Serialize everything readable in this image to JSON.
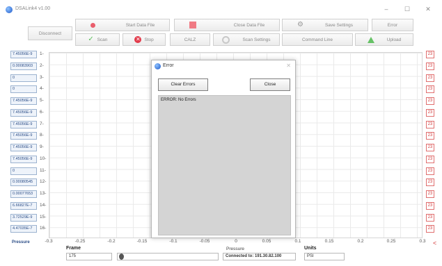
{
  "window": {
    "title": "DSALink4 v1.00",
    "minimize": "–",
    "maximize": "☐",
    "close": "✕"
  },
  "toolbar": {
    "disconnect": "Disconnect",
    "start_data_file": "Start Data File",
    "close_data_file": "Close Data File",
    "save_settings": "Save Settings",
    "error": "Error",
    "scan": "Scan",
    "stop": "Stop",
    "calz": "CALZ",
    "scan_settings": "Scan Settings",
    "command_line": "Command Line",
    "upload": "Upload"
  },
  "channels": [
    {
      "num": "1-",
      "value": "7.45056E-9",
      "right": "23"
    },
    {
      "num": "2-",
      "value": "0.00083903",
      "right": "23"
    },
    {
      "num": "3-",
      "value": "0",
      "right": "23"
    },
    {
      "num": "4-",
      "value": "0",
      "right": "23"
    },
    {
      "num": "5-",
      "value": "7.45056E-9",
      "right": "23"
    },
    {
      "num": "6-",
      "value": "7.45056E-9",
      "right": "23"
    },
    {
      "num": "7-",
      "value": "7.45056E-9",
      "right": "23"
    },
    {
      "num": "8-",
      "value": "7.45056E-9",
      "right": "23"
    },
    {
      "num": "9-",
      "value": "7.45056E-9",
      "right": "23"
    },
    {
      "num": "10-",
      "value": "7.45056E-9",
      "right": "23"
    },
    {
      "num": "11-",
      "value": "0",
      "right": "23"
    },
    {
      "num": "12-",
      "value": "0.00080545",
      "right": "23"
    },
    {
      "num": "13-",
      "value": "0.00077653",
      "right": "23"
    },
    {
      "num": "14-",
      "value": "6.66827E-7",
      "right": "23"
    },
    {
      "num": "15-",
      "value": "3.72529E-9",
      "right": "23"
    },
    {
      "num": "16-",
      "value": "4.47035E-7",
      "right": "23"
    }
  ],
  "plot": {
    "x_ticks": [
      "-0.3",
      "-0.25",
      "-0.2",
      "-0.15",
      "-0.1",
      "-0.05",
      "0",
      "0.05",
      "0.1",
      "0.15",
      "0.2",
      "0.25",
      "0.3"
    ],
    "x_label": "Pressure",
    "left_label": "Pressure",
    "marker": "<"
  },
  "footer": {
    "frame_label": "Frame",
    "frame_value": "175",
    "connection": "Connected to: 191.30.82.100",
    "units_label": "Units",
    "units_value": "PSI"
  },
  "dialog": {
    "title": "Error",
    "close": "✕",
    "clear_button": "Clear Errors",
    "close_button": "Close",
    "message": "ERROR: No Errors"
  },
  "colors": {
    "accent": "#2a4c86",
    "error": "#d43c3c",
    "dialog_area": "#d4d4d4"
  }
}
